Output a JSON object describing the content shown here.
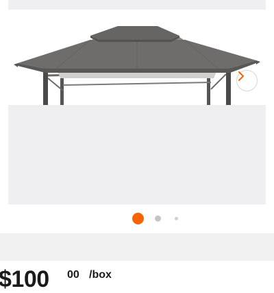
{
  "gallery": {
    "image_icon": "gazebo-canopy-photo",
    "next_icon": "chevron-right-icon",
    "accent_color": "#f96302",
    "dot_inactive_color": "#c4c4c4",
    "dot_small_color": "#cfcfcf",
    "page_count": 3,
    "active_index": 1
  },
  "price": {
    "dollars": "$100",
    "cents": "00",
    "unit": "/box"
  }
}
